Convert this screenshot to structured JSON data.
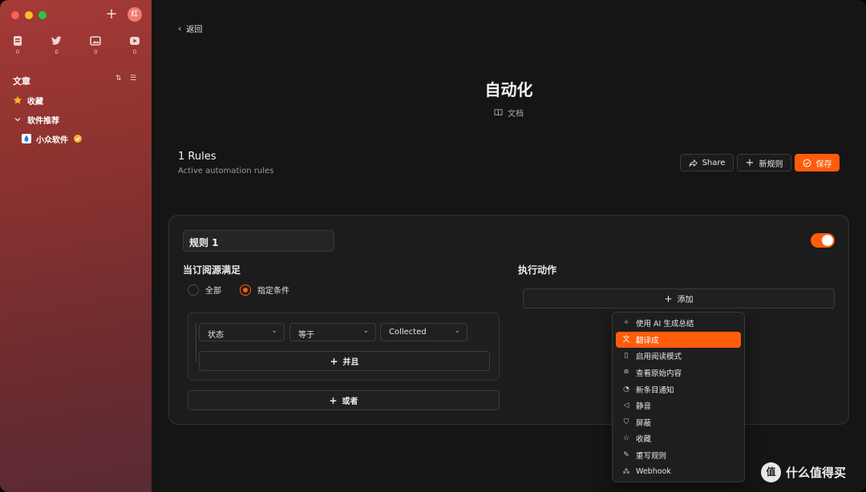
{
  "sidebar": {
    "avatar": "红",
    "feed_counts": [
      "0",
      "0",
      "0",
      "0"
    ],
    "section_title": "文章",
    "items": [
      {
        "label": "收藏"
      },
      {
        "label": "软件推荐"
      },
      {
        "label": "小众软件"
      }
    ],
    "accent_color": "#a43a37"
  },
  "header": {
    "back_label": "返回",
    "title": "自动化",
    "doc_label": "文档"
  },
  "rules": {
    "count_label": "1 Rules",
    "subtitle": "Active automation rules",
    "share_label": "Share",
    "new_label": "新规则",
    "save_label": "保存"
  },
  "rule": {
    "name": "规则 1",
    "enabled": true,
    "condition_title": "当订阅源满足",
    "radio_all": "全部",
    "radio_specific": "指定条件",
    "field": "状态",
    "operator": "等于",
    "value": "Collected",
    "and_label": "并且",
    "or_label": "或者",
    "action_title": "执行动作",
    "add_label": "添加"
  },
  "menu": {
    "items": [
      {
        "label": "使用 AI 生成总结",
        "icon": "sparkle-icon"
      },
      {
        "label": "翻译成",
        "icon": "translate-icon",
        "active": true
      },
      {
        "label": "启用阅读模式",
        "icon": "reader-icon"
      },
      {
        "label": "查看原始内容",
        "icon": "database-icon"
      },
      {
        "label": "新条目通知",
        "icon": "bell-icon"
      },
      {
        "label": "静音",
        "icon": "mute-icon"
      },
      {
        "label": "屏蔽",
        "icon": "shield-icon"
      },
      {
        "label": "收藏",
        "icon": "star-icon"
      },
      {
        "label": "重写规则",
        "icon": "pen-icon"
      },
      {
        "label": "Webhook",
        "icon": "webhook-icon"
      }
    ]
  },
  "watermark": {
    "text": "什么值得买"
  },
  "colors": {
    "accent": "#ff5c0b"
  }
}
